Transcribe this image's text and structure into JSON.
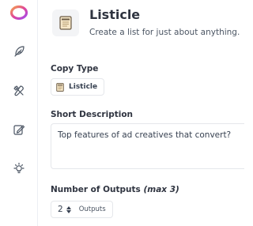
{
  "sidebar": {
    "items": [
      {
        "icon": "logo-ring-icon"
      },
      {
        "icon": "feather-icon"
      },
      {
        "icon": "tools-icon"
      },
      {
        "icon": "edit-icon"
      },
      {
        "icon": "lightbulb-icon"
      }
    ]
  },
  "header": {
    "title": "Listicle",
    "subtitle": "Create a list for just about anything."
  },
  "copy_type": {
    "label": "Copy Type",
    "value": "Listicle"
  },
  "short_description": {
    "label": "Short Description",
    "value": "Top features of ad creatives that convert?"
  },
  "outputs": {
    "label": "Number of Outputs",
    "hint": "(max 3)",
    "value": "2",
    "unit": "Outputs"
  },
  "colors": {
    "logo_gradient_start": "#f4a24e",
    "logo_gradient_end": "#a24cf0"
  }
}
